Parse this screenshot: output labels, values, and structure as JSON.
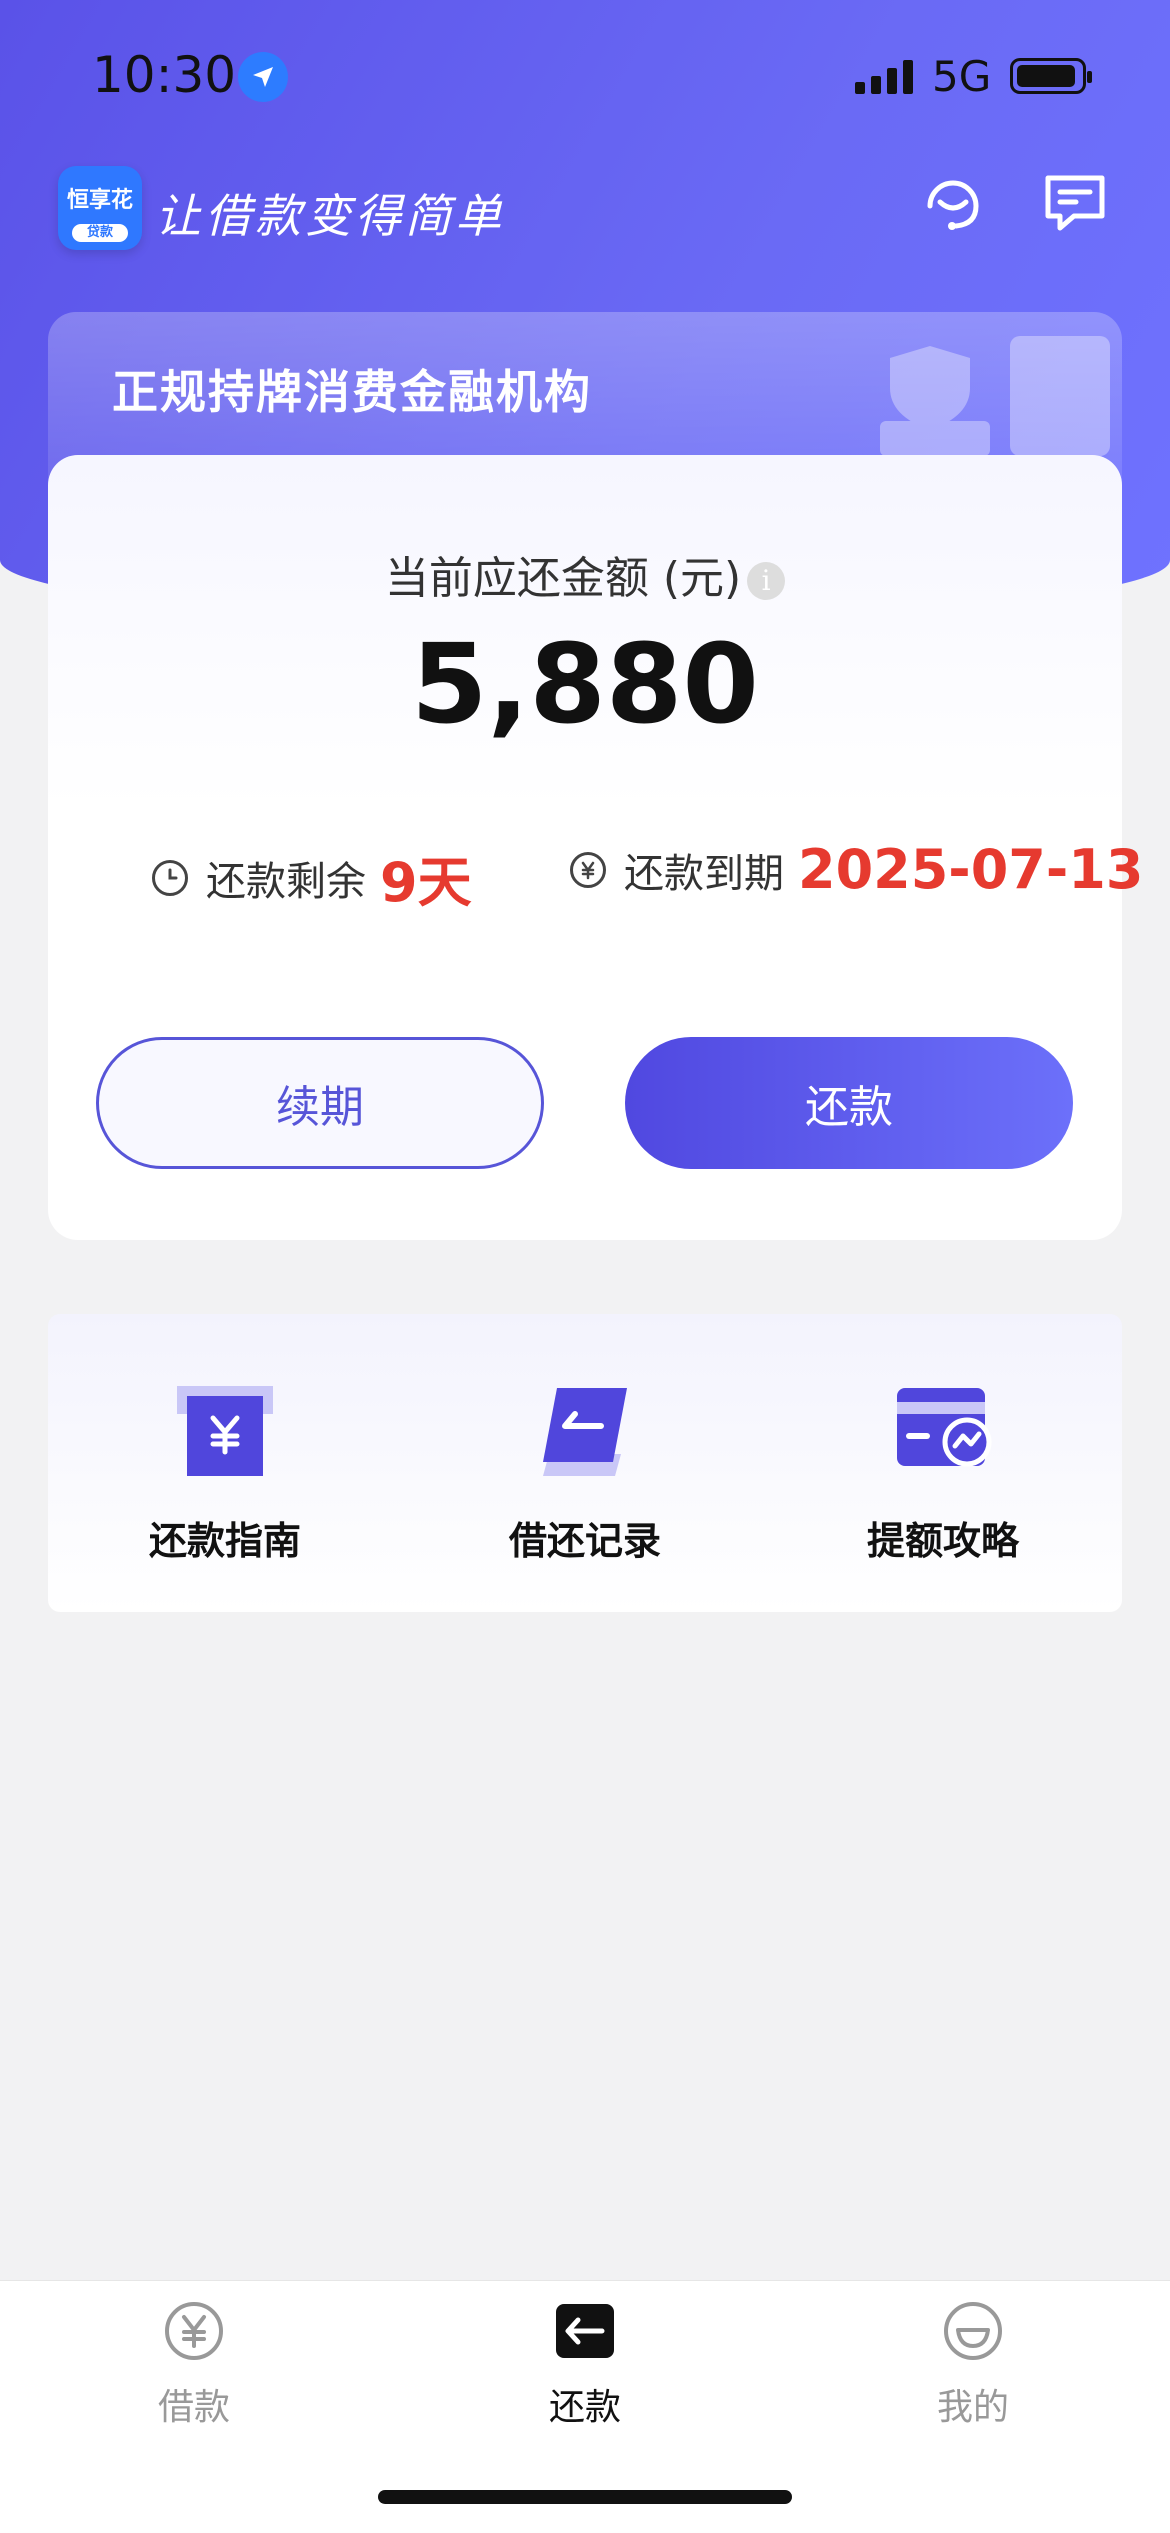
{
  "status_bar": {
    "time": "10:30",
    "network": "5G"
  },
  "header": {
    "logo_top": "恒享花",
    "logo_bottom": "贷款",
    "slogan": "让借款变得简单",
    "icons": [
      "headset-icon",
      "message-icon"
    ]
  },
  "license_text": "正规持牌消费金融机构",
  "repayment": {
    "amount_label": "当前应还金额 (元)",
    "info_icon": "i",
    "amount": "5,880",
    "remaining_label": "还款剩余",
    "remaining_value": "9天",
    "due_label": "还款到期",
    "due_value": "2025-07-13",
    "renew_button": "续期",
    "repay_button": "还款"
  },
  "shortcuts": [
    {
      "label": "还款指南",
      "icon": "yuan-box-icon"
    },
    {
      "label": "借还记录",
      "icon": "record-icon"
    },
    {
      "label": "提额攻略",
      "icon": "card-growth-icon"
    }
  ],
  "bottom_nav": [
    {
      "label": "借款",
      "icon": "yuan-circle-icon",
      "active": false
    },
    {
      "label": "还款",
      "icon": "return-arrow-icon",
      "active": true
    },
    {
      "label": "我的",
      "icon": "smile-icon",
      "active": false
    }
  ],
  "colors": {
    "accent": "#5a52e8",
    "red": "#e63a2f"
  }
}
